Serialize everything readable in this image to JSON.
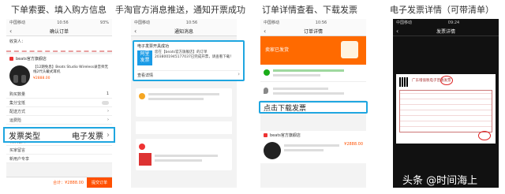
{
  "captions": [
    "下单索要、填入购方信息",
    "手淘官方消息推送，通知开票成功",
    "订单详情查看、下载发票",
    "电子发票详情（可带清单）"
  ],
  "p1": {
    "status_left": "中国移动",
    "time": "10:56",
    "battery": "93%",
    "title": "确认订单",
    "receiver": "收货人：",
    "store": "beats官方旗舰店",
    "product": "【12期免息】Beats Studio Wireless录音师无线2代头戴式耳机",
    "price": "¥2888.00",
    "qty": "1",
    "rows": [
      "购买数量",
      "集分宝抵",
      "配送方式",
      "运费险",
      "发票类型",
      "发票抬头",
      "买家留言",
      "新用户专享"
    ],
    "invoice_label": "发票类型",
    "invoice_value": "电子发票",
    "footer_total": "合计：¥2888.00",
    "submit": "提交订单"
  },
  "p2": {
    "status_left": "中国移动",
    "time": "10:56",
    "title": "通知消息",
    "card_title": "电子发票开具成功",
    "card_text": "您在【beats官方旗舰店】的订单2038001945177037已完成开票，请查看下载！",
    "logo_line1": "阿里",
    "logo_line2": "发票",
    "view_detail": "查看详情"
  },
  "p3": {
    "status_left": "中国移动",
    "time": "10:56",
    "title": "订单详情",
    "hero_text": "卖家已发货",
    "download": "点击下载发票",
    "store": "beats官方旗舰店",
    "price": "¥2888.00"
  },
  "p4": {
    "status_left": "中国移动",
    "time": "09:24",
    "title": "发票详情",
    "invoice_heading": "广东增值税电子普通发票"
  },
  "watermark": "头条 @时间海上"
}
